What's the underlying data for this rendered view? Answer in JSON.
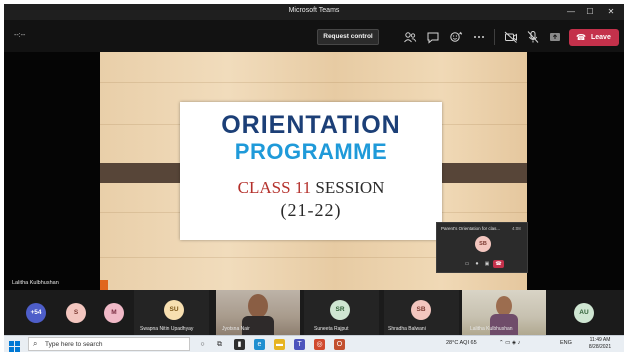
{
  "window": {
    "title": "Microsoft Teams",
    "minimize_glyph": "—",
    "maximize_glyph": "☐",
    "close_glyph": "✕"
  },
  "toolbar": {
    "timer": "--:--",
    "request_control": "Request control",
    "leave": "Leave",
    "icons": [
      "people-icon",
      "chat-icon",
      "reactions-icon",
      "more-icon",
      "camera-off-icon",
      "mic-off-icon",
      "share-tray-icon"
    ]
  },
  "slide": {
    "line1": "ORIENTATION",
    "line2": "PROGRAMME",
    "line3_class": "CLASS 11",
    "line3_session": "SESSION",
    "line4": "(21-22)",
    "colors": {
      "heading_dark": "#1c3f77",
      "heading_light": "#1f9ad9",
      "class": "#b4302b"
    }
  },
  "presenter_name": "Lalitha Kulbhushan",
  "mini_window": {
    "title": "Parent's Orientation for clas...",
    "timer": "4:08",
    "avatar": "SB"
  },
  "participants": [
    {
      "initials": "+54",
      "name": "",
      "type": "overflow",
      "bg": "#4e5ec9",
      "fg": "#ffffff"
    },
    {
      "initials": "S",
      "name": "",
      "type": "avatar",
      "bg": "#f3c6bf",
      "fg": "#7d3a32"
    },
    {
      "initials": "M",
      "name": "",
      "type": "avatar",
      "bg": "#f0b9c7",
      "fg": "#7a2d42"
    },
    {
      "initials": "SU",
      "name": "Swapna Nitin Upadhyay",
      "type": "avatar",
      "bg": "#f7dfb0",
      "fg": "#7a5415"
    },
    {
      "initials": "",
      "name": "Jyotsna Nair",
      "type": "video"
    },
    {
      "initials": "SR",
      "name": "Suneeta Rajput",
      "type": "avatar",
      "bg": "#cfe6d2",
      "fg": "#2f5f36"
    },
    {
      "initials": "SB",
      "name": "Shradha Balwani",
      "type": "avatar",
      "bg": "#f3c6bf",
      "fg": "#7d3a32"
    },
    {
      "initials": "",
      "name": "Lalitha Kulbhushan",
      "type": "video"
    },
    {
      "initials": "AU",
      "name": "",
      "type": "avatar",
      "bg": "#cfe6d2",
      "fg": "#2f5f36"
    }
  ],
  "taskbar": {
    "search_placeholder": "Type here to search",
    "weather": "28°C  AQI 65",
    "language": "ENG",
    "time": "11:49 AM",
    "date": "8/28/2021"
  }
}
